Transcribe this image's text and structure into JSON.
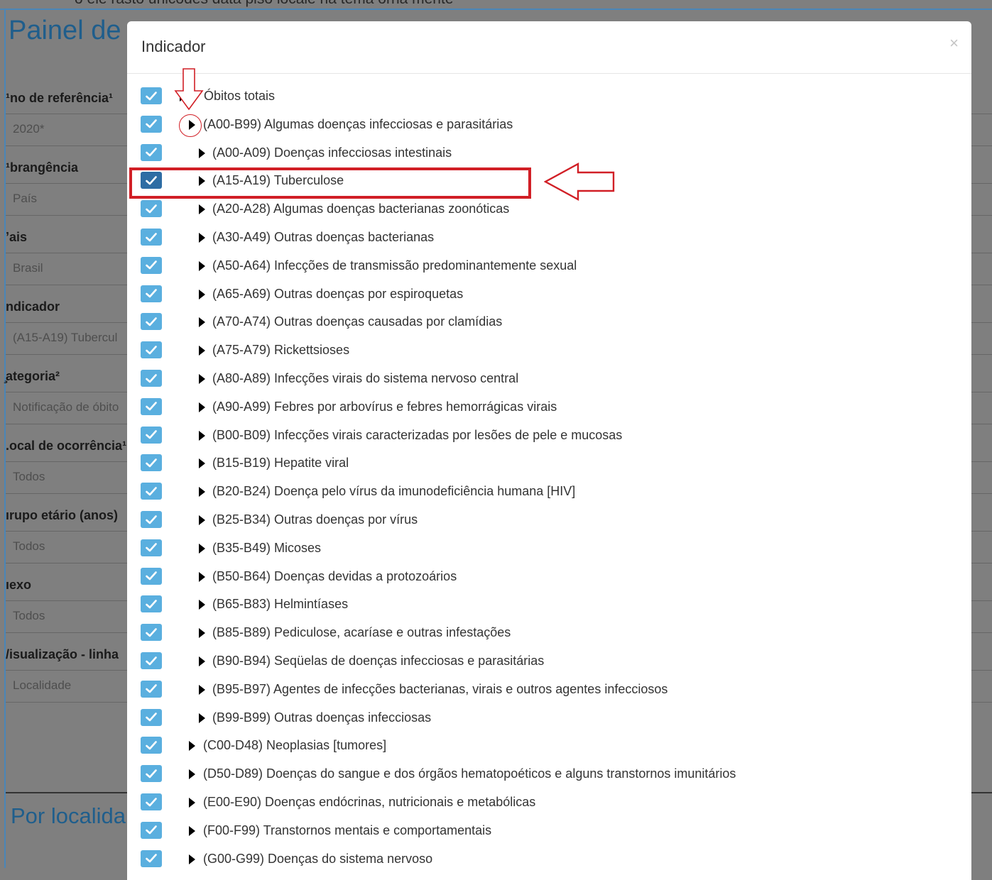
{
  "background": {
    "top_text": "o ele rasto unicodes data piso locale na tema orna mente",
    "page_title": "Painel de",
    "section_title": "Por localida",
    "filters": [
      {
        "label": "¹no de referência¹",
        "value": "2020*"
      },
      {
        "label": "¹brangência",
        "value": "País"
      },
      {
        "label": "’ais",
        "value": "Brasil"
      },
      {
        "label": "ndicador",
        "value": "(A15-A19) Tubercul"
      },
      {
        "label": "̧ategoria²",
        "value": "Notificação de óbito"
      },
      {
        "label": ".ocal de ocorrência¹",
        "value": "Todos"
      },
      {
        "label": "ırupo etário (anos)",
        "value": "Todos"
      },
      {
        "label": "ıexo",
        "value": "Todos"
      },
      {
        "label": "/isualização - linha",
        "value": "Localidade"
      }
    ]
  },
  "modal": {
    "title": "Indicador",
    "close_label": "×",
    "items": [
      {
        "label": "Óbitos totais",
        "level": 0,
        "checked": true,
        "has_caret": true
      },
      {
        "label": "(A00-B99) Algumas doenças infecciosas e parasitárias",
        "level": 1,
        "checked": true,
        "has_caret": true
      },
      {
        "label": "(A00-A09) Doenças infecciosas intestinais",
        "level": 2,
        "checked": true,
        "has_caret": true
      },
      {
        "label": "(A15-A19) Tuberculose",
        "level": 2,
        "checked": true,
        "selected": true,
        "has_caret": true
      },
      {
        "label": "(A20-A28) Algumas doenças bacterianas zoonóticas",
        "level": 2,
        "checked": true,
        "has_caret": true
      },
      {
        "label": "(A30-A49) Outras doenças bacterianas",
        "level": 2,
        "checked": true,
        "has_caret": true
      },
      {
        "label": "(A50-A64) Infecções de transmissão predominantemente sexual",
        "level": 2,
        "checked": true,
        "has_caret": true
      },
      {
        "label": "(A65-A69) Outras doenças por espiroquetas",
        "level": 2,
        "checked": true,
        "has_caret": true
      },
      {
        "label": "(A70-A74) Outras doenças causadas por clamídias",
        "level": 2,
        "checked": true,
        "has_caret": true
      },
      {
        "label": "(A75-A79) Rickettsioses",
        "level": 2,
        "checked": true,
        "has_caret": true
      },
      {
        "label": "(A80-A89) Infecções virais do sistema nervoso central",
        "level": 2,
        "checked": true,
        "has_caret": true
      },
      {
        "label": "(A90-A99) Febres por arbovírus e febres hemorrágicas virais",
        "level": 2,
        "checked": true,
        "has_caret": true
      },
      {
        "label": "(B00-B09) Infecções virais caracterizadas por lesões de pele e mucosas",
        "level": 2,
        "checked": true,
        "has_caret": true
      },
      {
        "label": "(B15-B19) Hepatite viral",
        "level": 2,
        "checked": true,
        "has_caret": true
      },
      {
        "label": "(B20-B24) Doença pelo vírus da imunodeficiência humana [HIV]",
        "level": 2,
        "checked": true,
        "has_caret": true
      },
      {
        "label": "(B25-B34) Outras doenças por vírus",
        "level": 2,
        "checked": true,
        "has_caret": true
      },
      {
        "label": "(B35-B49) Micoses",
        "level": 2,
        "checked": true,
        "has_caret": true
      },
      {
        "label": "(B50-B64) Doenças devidas a protozoários",
        "level": 2,
        "checked": true,
        "has_caret": true
      },
      {
        "label": "(B65-B83) Helmintíases",
        "level": 2,
        "checked": true,
        "has_caret": true
      },
      {
        "label": "(B85-B89) Pediculose, acaríase e outras infestações",
        "level": 2,
        "checked": true,
        "has_caret": true
      },
      {
        "label": "(B90-B94) Seqüelas de doenças infecciosas e parasitárias",
        "level": 2,
        "checked": true,
        "has_caret": true
      },
      {
        "label": "(B95-B97) Agentes de infecções bacterianas, virais e outros agentes infecciosos",
        "level": 2,
        "checked": true,
        "has_caret": true
      },
      {
        "label": "(B99-B99) Outras doenças infecciosas",
        "level": 2,
        "checked": true,
        "has_caret": true
      },
      {
        "label": "(C00-D48) Neoplasias [tumores]",
        "level": 1,
        "checked": true,
        "has_caret": true
      },
      {
        "label": "(D50-D89) Doenças do sangue e dos órgãos hematopoéticos e alguns transtornos imunitários",
        "level": 1,
        "checked": true,
        "has_caret": true
      },
      {
        "label": "(E00-E90) Doenças endócrinas, nutricionais e metabólicas",
        "level": 1,
        "checked": true,
        "has_caret": true
      },
      {
        "label": "(F00-F99) Transtornos mentais e comportamentais",
        "level": 1,
        "checked": true,
        "has_caret": true
      },
      {
        "label": "(G00-G99) Doenças do sistema nervoso",
        "level": 1,
        "checked": true,
        "has_caret": true
      }
    ]
  },
  "colors": {
    "checkbox": "#5aafdf",
    "checkbox_selected": "#2e6da4",
    "annotation_red": "#d11f26",
    "title_blue": "#1f5e8c"
  }
}
